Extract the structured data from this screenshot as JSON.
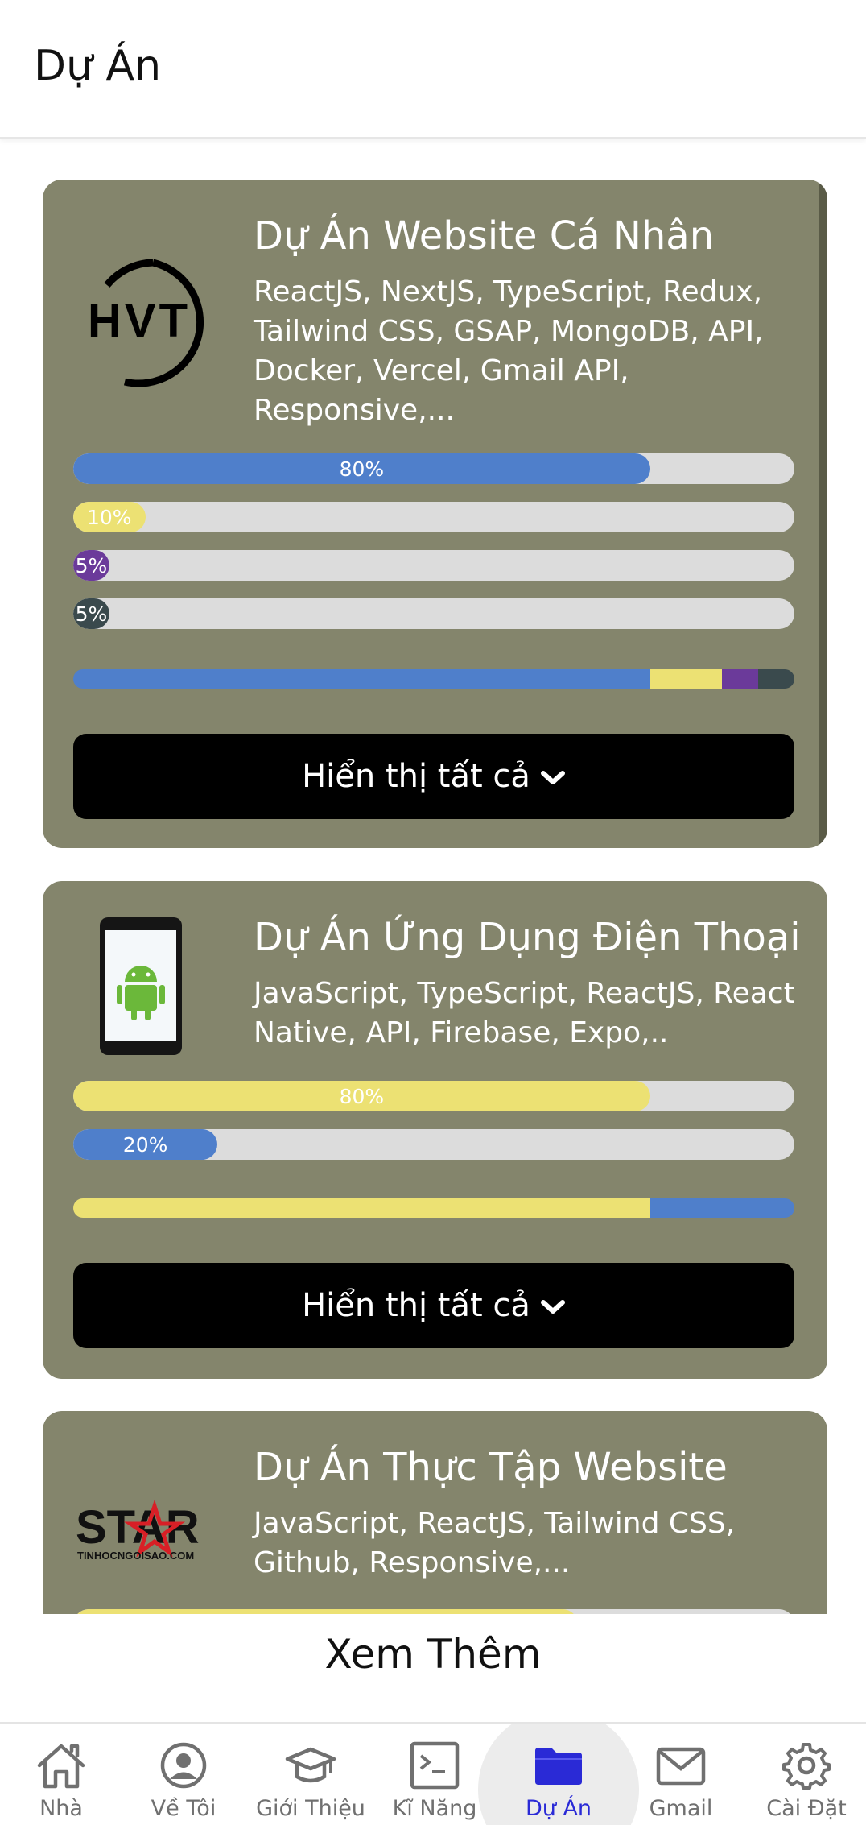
{
  "header": {
    "title": "Dự Án"
  },
  "projects": [
    {
      "title": "Dự Án Website Cá Nhân",
      "tech": "ReactJS, NextJS, TypeScript, Redux, Tailwind CSS, GSAP, MongoDB, API, Docker, Vercel, Gmail API, Responsive,...",
      "logo_icon": "hvt-logo",
      "logo_text": "HVT",
      "bars": [
        {
          "label": "80%",
          "value": 80,
          "color": "#4f7fcb"
        },
        {
          "label": "10%",
          "value": 10,
          "color": "#ece173"
        },
        {
          "label": "5%",
          "value": 5,
          "color": "#6b3a9a"
        },
        {
          "label": "5%",
          "value": 5,
          "color": "#3a4a4d"
        }
      ],
      "button_label": "Hiển thị tất cả"
    },
    {
      "title": "Dự Án Ứng Dụng Điện Thoại",
      "tech": "JavaScript, TypeScript, ReactJS, React Native, API, Firebase, Expo,..",
      "logo_icon": "android-phone-icon",
      "bars": [
        {
          "label": "80%",
          "value": 80,
          "color": "#ece173"
        },
        {
          "label": "20%",
          "value": 20,
          "color": "#4f7fcb"
        }
      ],
      "button_label": "Hiển thị tất cả"
    },
    {
      "title": "Dự Án Thực Tập Website",
      "tech": "JavaScript, ReactJS, Tailwind CSS, Github, Responsive,...",
      "logo_icon": "star-logo",
      "logo_text": "STAR",
      "logo_subtext": "TINHOCNGOISAO.COM",
      "bars": [
        {
          "label": "",
          "value": 70,
          "color": "#ece173"
        }
      ]
    }
  ],
  "more_label": "Xem Thêm",
  "nav": {
    "items": [
      {
        "label": "Nhà",
        "icon": "home-icon"
      },
      {
        "label": "Về Tôi",
        "icon": "user-icon"
      },
      {
        "label": "Giới Thiệu",
        "icon": "graduation-cap-icon"
      },
      {
        "label": "Kĩ Năng",
        "icon": "terminal-icon"
      },
      {
        "label": "Dự Án",
        "icon": "folder-icon",
        "active": true
      },
      {
        "label": "Gmail",
        "icon": "mail-icon"
      },
      {
        "label": "Cài Đặt",
        "icon": "gear-icon"
      }
    ],
    "active_color": "#2a2ad6",
    "inactive_color": "#707070"
  },
  "colors": {
    "card": "#84856c",
    "button": "#000000",
    "track": "#dcdcdc"
  }
}
